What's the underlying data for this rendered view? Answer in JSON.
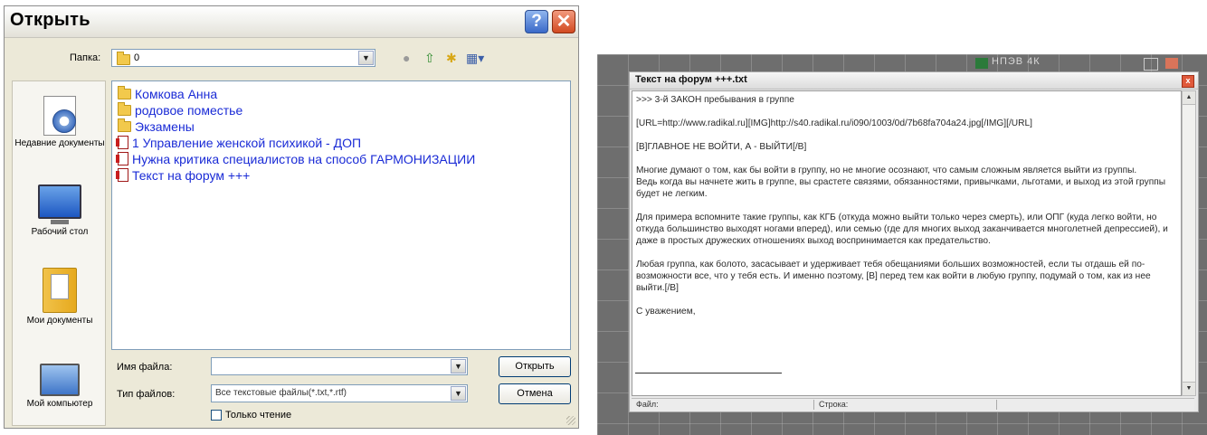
{
  "open_dialog": {
    "title": "Открыть",
    "help_label": "?",
    "close_label": "✕",
    "folder_label": "Папка:",
    "folder_value": "0",
    "places": [
      {
        "id": "recent",
        "label": "Недавние документы",
        "icon": "recent-documents-icon"
      },
      {
        "id": "desktop",
        "label": "Рабочий стол",
        "icon": "desktop-icon"
      },
      {
        "id": "mydocs",
        "label": "Мои документы",
        "icon": "my-documents-icon"
      },
      {
        "id": "mycomp",
        "label": "Мой компьютер",
        "icon": "my-computer-icon"
      }
    ],
    "files": [
      {
        "name": "Комкова Анна",
        "kind": "folder"
      },
      {
        "name": "родовое поместье",
        "kind": "folder"
      },
      {
        "name": "Экзамены",
        "kind": "folder"
      },
      {
        "name": "1 Управление женской психикой - ДОП",
        "kind": "doc"
      },
      {
        "name": "Нужна критика специалистов на способ ГАРМОНИЗАЦИИ",
        "kind": "doc"
      },
      {
        "name": "Текст на форум +++",
        "kind": "doc"
      }
    ],
    "filename_label": "Имя файла:",
    "filename_value": "",
    "filetype_label": "Тип файлов:",
    "filetype_value": "Все текстовые файлы(*.txt,*.rtf)",
    "readonly_label": "Только чтение",
    "open_button": "Открыть",
    "cancel_button": "Отмена"
  },
  "editor": {
    "title": "Текст на форум +++.txt",
    "close_label": "x",
    "text": ">>> 3-й ЗАКОН пребывания в группе\n\n[URL=http://www.radikal.ru][IMG]http://s40.radikal.ru/i090/1003/0d/7b68fa704a24.jpg[/IMG][/URL]\n\n[B]ГЛАВНОЕ НЕ ВОЙТИ, А - ВЫЙТИ[/B]\n\nМногие думают о том, как бы войти в группу, но не многие осознают, что самым сложным является выйти из группы.\nВедь когда вы начнете жить в группе, вы срастете связями, обязанностями, привычками, льготами, и выход из этой группы будет не легким.\n\nДля примера вспомните такие группы, как КГБ (откуда можно выйти только через смерть), или ОПГ (куда легко войти, но откуда большинство выходят ногами вперед), или семью (где для многих выход заканчивается многолетней депрессией), и даже в простых дружеских отношениях выход воспринимается как предательство.\n\nЛюбая группа, как болото, засасывает и удерживает тебя обещаниями больших возможностей, если ты отдашь ей по-возможности все, что у тебя есть. И именно поэтому, [B] перед тем как войти в любую группу, подумай о том, как из нее выйти.[/B]\n\nС уважением,",
    "status_file": "Файл:",
    "status_line": "Строка:"
  },
  "background": {
    "strip_text": "НПЭВ 4К"
  }
}
